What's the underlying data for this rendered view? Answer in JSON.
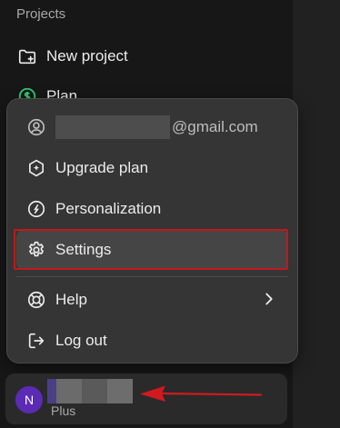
{
  "sidebar": {
    "section_title": "Projects",
    "new_project_label": "New project",
    "plan_label": "Plan"
  },
  "menu": {
    "account_email_suffix": "@gmail.com",
    "upgrade_label": "Upgrade plan",
    "personalization_label": "Personalization",
    "settings_label": "Settings",
    "help_label": "Help",
    "logout_label": "Log out"
  },
  "user": {
    "avatar_initial": "N",
    "plan": "Plus"
  },
  "colors": {
    "background": "#171717",
    "menu_background": "#353535",
    "selected_row": "#454545",
    "highlight_border": "#c0181e",
    "avatar": "#5b2bb5",
    "arrow": "#d11a1f"
  },
  "icons": {
    "new_project": "folder-plus-icon",
    "plan": "dollar-circle-icon",
    "account": "user-circle-icon",
    "upgrade": "hexagon-sparkle-icon",
    "personalization": "personalization-icon",
    "settings": "gear-icon",
    "help": "lifebuoy-icon",
    "logout": "logout-icon"
  }
}
